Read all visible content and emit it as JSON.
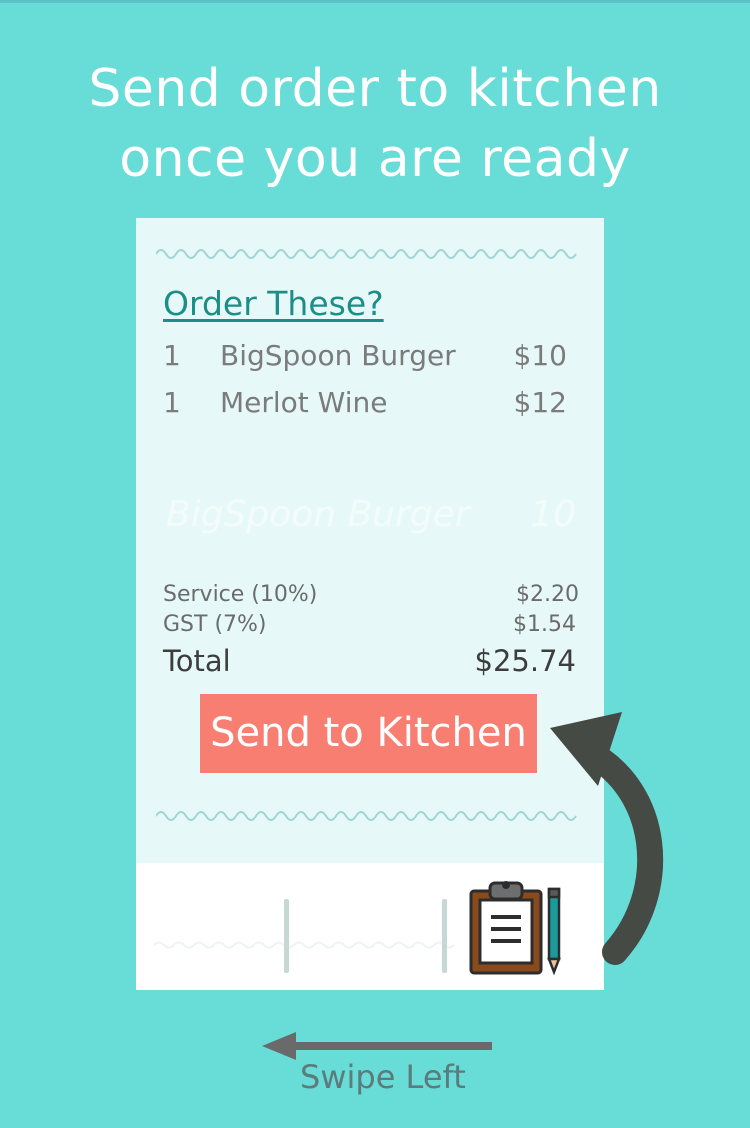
{
  "headline": {
    "line1": "Send order to kitchen",
    "line2": "once you are ready"
  },
  "order": {
    "title": "Order These?",
    "items": [
      {
        "qty": "1",
        "name": "BigSpoon Burger",
        "price": "$10"
      },
      {
        "qty": "1",
        "name": "Merlot Wine",
        "price": "$12"
      }
    ],
    "ghost_item": {
      "name": "BigSpoon Burger",
      "price": "10"
    }
  },
  "summary": {
    "service_label": "Service (10%)",
    "service_value": "$2.20",
    "gst_label": "GST (7%)",
    "gst_value": "$1.54",
    "total_label": "Total",
    "total_value": "$25.74"
  },
  "actions": {
    "send_label": "Send to Kitchen"
  },
  "hint": {
    "swipe_label": "Swipe Left"
  },
  "icons": {
    "clipboard": "clipboard-icon",
    "curved_arrow": "curved-arrow-icon",
    "left_arrow": "left-arrow-icon"
  },
  "colors": {
    "background": "#68dcd7",
    "card": "#e6f9f8",
    "accent_title": "#1c8d87",
    "button": "#f77e71",
    "arrow": "#454a45"
  }
}
